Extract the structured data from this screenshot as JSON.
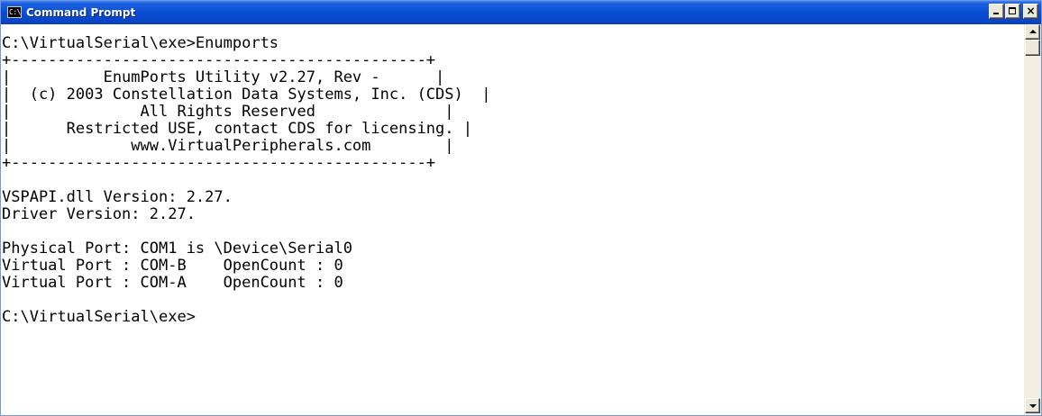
{
  "window": {
    "title": "Command Prompt",
    "icon": "console-icon",
    "icon_glyph": "C:\\",
    "controls": {
      "minimize": "minimize-icon",
      "maximize": "maximize-icon",
      "close": "×"
    }
  },
  "console": {
    "lines": [
      "C:\\VirtualSerial\\exe>Enumports",
      "+---------------------------------------------+",
      "|          EnumPorts Utility v2.27, Rev -      |",
      "|  (c) 2003 Constellation Data Systems, Inc. (CDS)  |",
      "|              All Rights Reserved              |",
      "|      Restricted USE, contact CDS for licensing. |",
      "|             www.VirtualPeripherals.com        |",
      "+---------------------------------------------+",
      "",
      "VSPAPI.dll Version: 2.27.",
      "Driver Version: 2.27.",
      "",
      "Physical Port: COM1 is \\Device\\Serial0",
      "Virtual Port : COM-B    OpenCount : 0",
      "Virtual Port : COM-A    OpenCount : 0",
      "",
      "C:\\VirtualSerial\\exe>"
    ]
  },
  "scrollbar": {
    "up_icon": "arrow-up-icon",
    "down_icon": "arrow-down-icon",
    "position": 0
  },
  "colors": {
    "titlebar": "#0a4ed3",
    "console_bg": "#ffffff",
    "console_text": "#000000"
  }
}
